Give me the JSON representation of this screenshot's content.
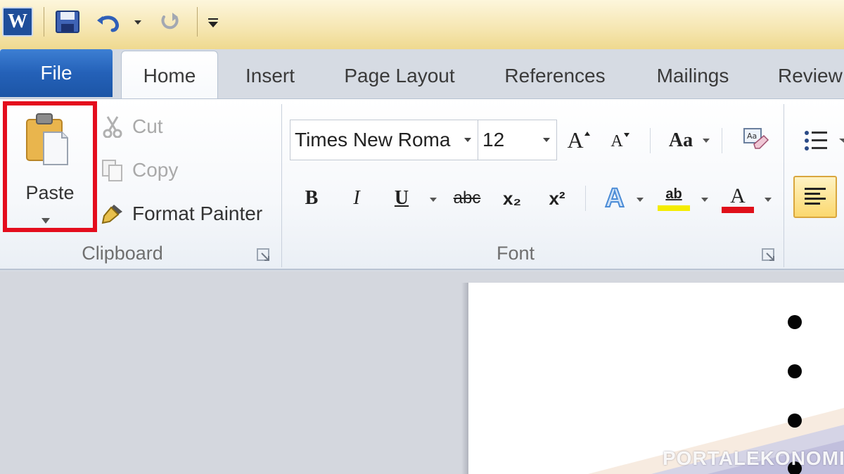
{
  "quick_access": {
    "app_logo_letter": "W",
    "icons": [
      "word-logo",
      "save-icon",
      "undo-icon",
      "undo-dropdown-arrow",
      "redo-icon",
      "customize-quick-access-arrow"
    ]
  },
  "tabs": [
    {
      "label": "File"
    },
    {
      "label": "Home"
    },
    {
      "label": "Insert"
    },
    {
      "label": "Page Layout"
    },
    {
      "label": "References"
    },
    {
      "label": "Mailings"
    },
    {
      "label": "Review"
    }
  ],
  "clipboard": {
    "paste_label": "Paste",
    "cut_label": "Cut",
    "copy_label": "Copy",
    "format_painter_label": "Format Painter",
    "group_label": "Clipboard",
    "highlight_color": "#e40d1d"
  },
  "font": {
    "font_name": "Times New Roma",
    "font_size": "12",
    "group_label": "Font",
    "bold_glyph": "B",
    "italic_glyph": "I",
    "underline_glyph": "U",
    "strike_glyph": "abc",
    "subscript_glyph": "x₂",
    "superscript_glyph": "x²",
    "change_case_glyph": "Aa",
    "grow_glyph": "A",
    "shrink_glyph": "A",
    "text_effects_glyph": "A",
    "highlight_glyph": "ab",
    "font_color_glyph": "A",
    "highlight_color": "#f4ec00",
    "font_color": "#e0101a"
  },
  "document": {
    "bullet_count": 4
  },
  "watermark": {
    "text": "PORTALEKONOMI"
  },
  "colors": {
    "file_tab": "#2461b8",
    "title_bar": "#f6e7b4",
    "active_align": "#fde9a6"
  }
}
